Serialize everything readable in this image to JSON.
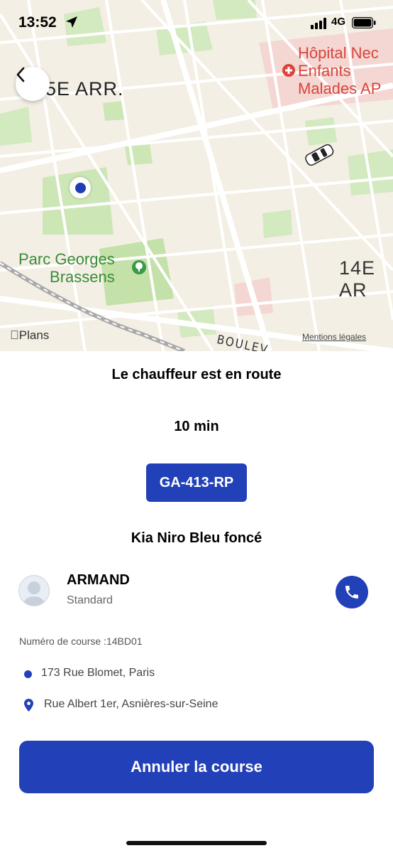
{
  "status_bar": {
    "time": "13:52",
    "network": "4G",
    "location_icon": "location-arrow-icon",
    "signal_icon": "signal-bars-icon",
    "battery_icon": "battery-icon"
  },
  "map": {
    "back_icon": "chevron-left-icon",
    "labels": {
      "arr_left": "5E ARR.",
      "arr_right": "14E AR",
      "hospital": "Hôpital Nec\nEnfants\nMalades AP",
      "park": "Parc Georges\nBrassens",
      "boulevard": "BOULEV"
    },
    "attribution": "Plans",
    "legal": "Mentions légales",
    "colors": {
      "land": "#f3efe4",
      "green": "#c9e3b1",
      "hospital_zone": "#f4d6d3",
      "road": "#ffffff",
      "rail": "#a9a9a9"
    }
  },
  "ride": {
    "status_title": "Le chauffeur est en route",
    "eta": "10 min",
    "plate": "GA-413-RP",
    "car_model": "Kia Niro Bleu foncé",
    "driver": {
      "name": "ARMAND",
      "class": "Standard"
    },
    "ride_number": "Numéro de course :14BD01",
    "pickup": "173 Rue Blomet, Paris",
    "destination": "Rue Albert 1er, Asnières-sur-Seine",
    "cancel_label": "Annuler la course"
  },
  "colors": {
    "accent": "#2240b7",
    "text": "#000000",
    "muted": "#666666"
  }
}
